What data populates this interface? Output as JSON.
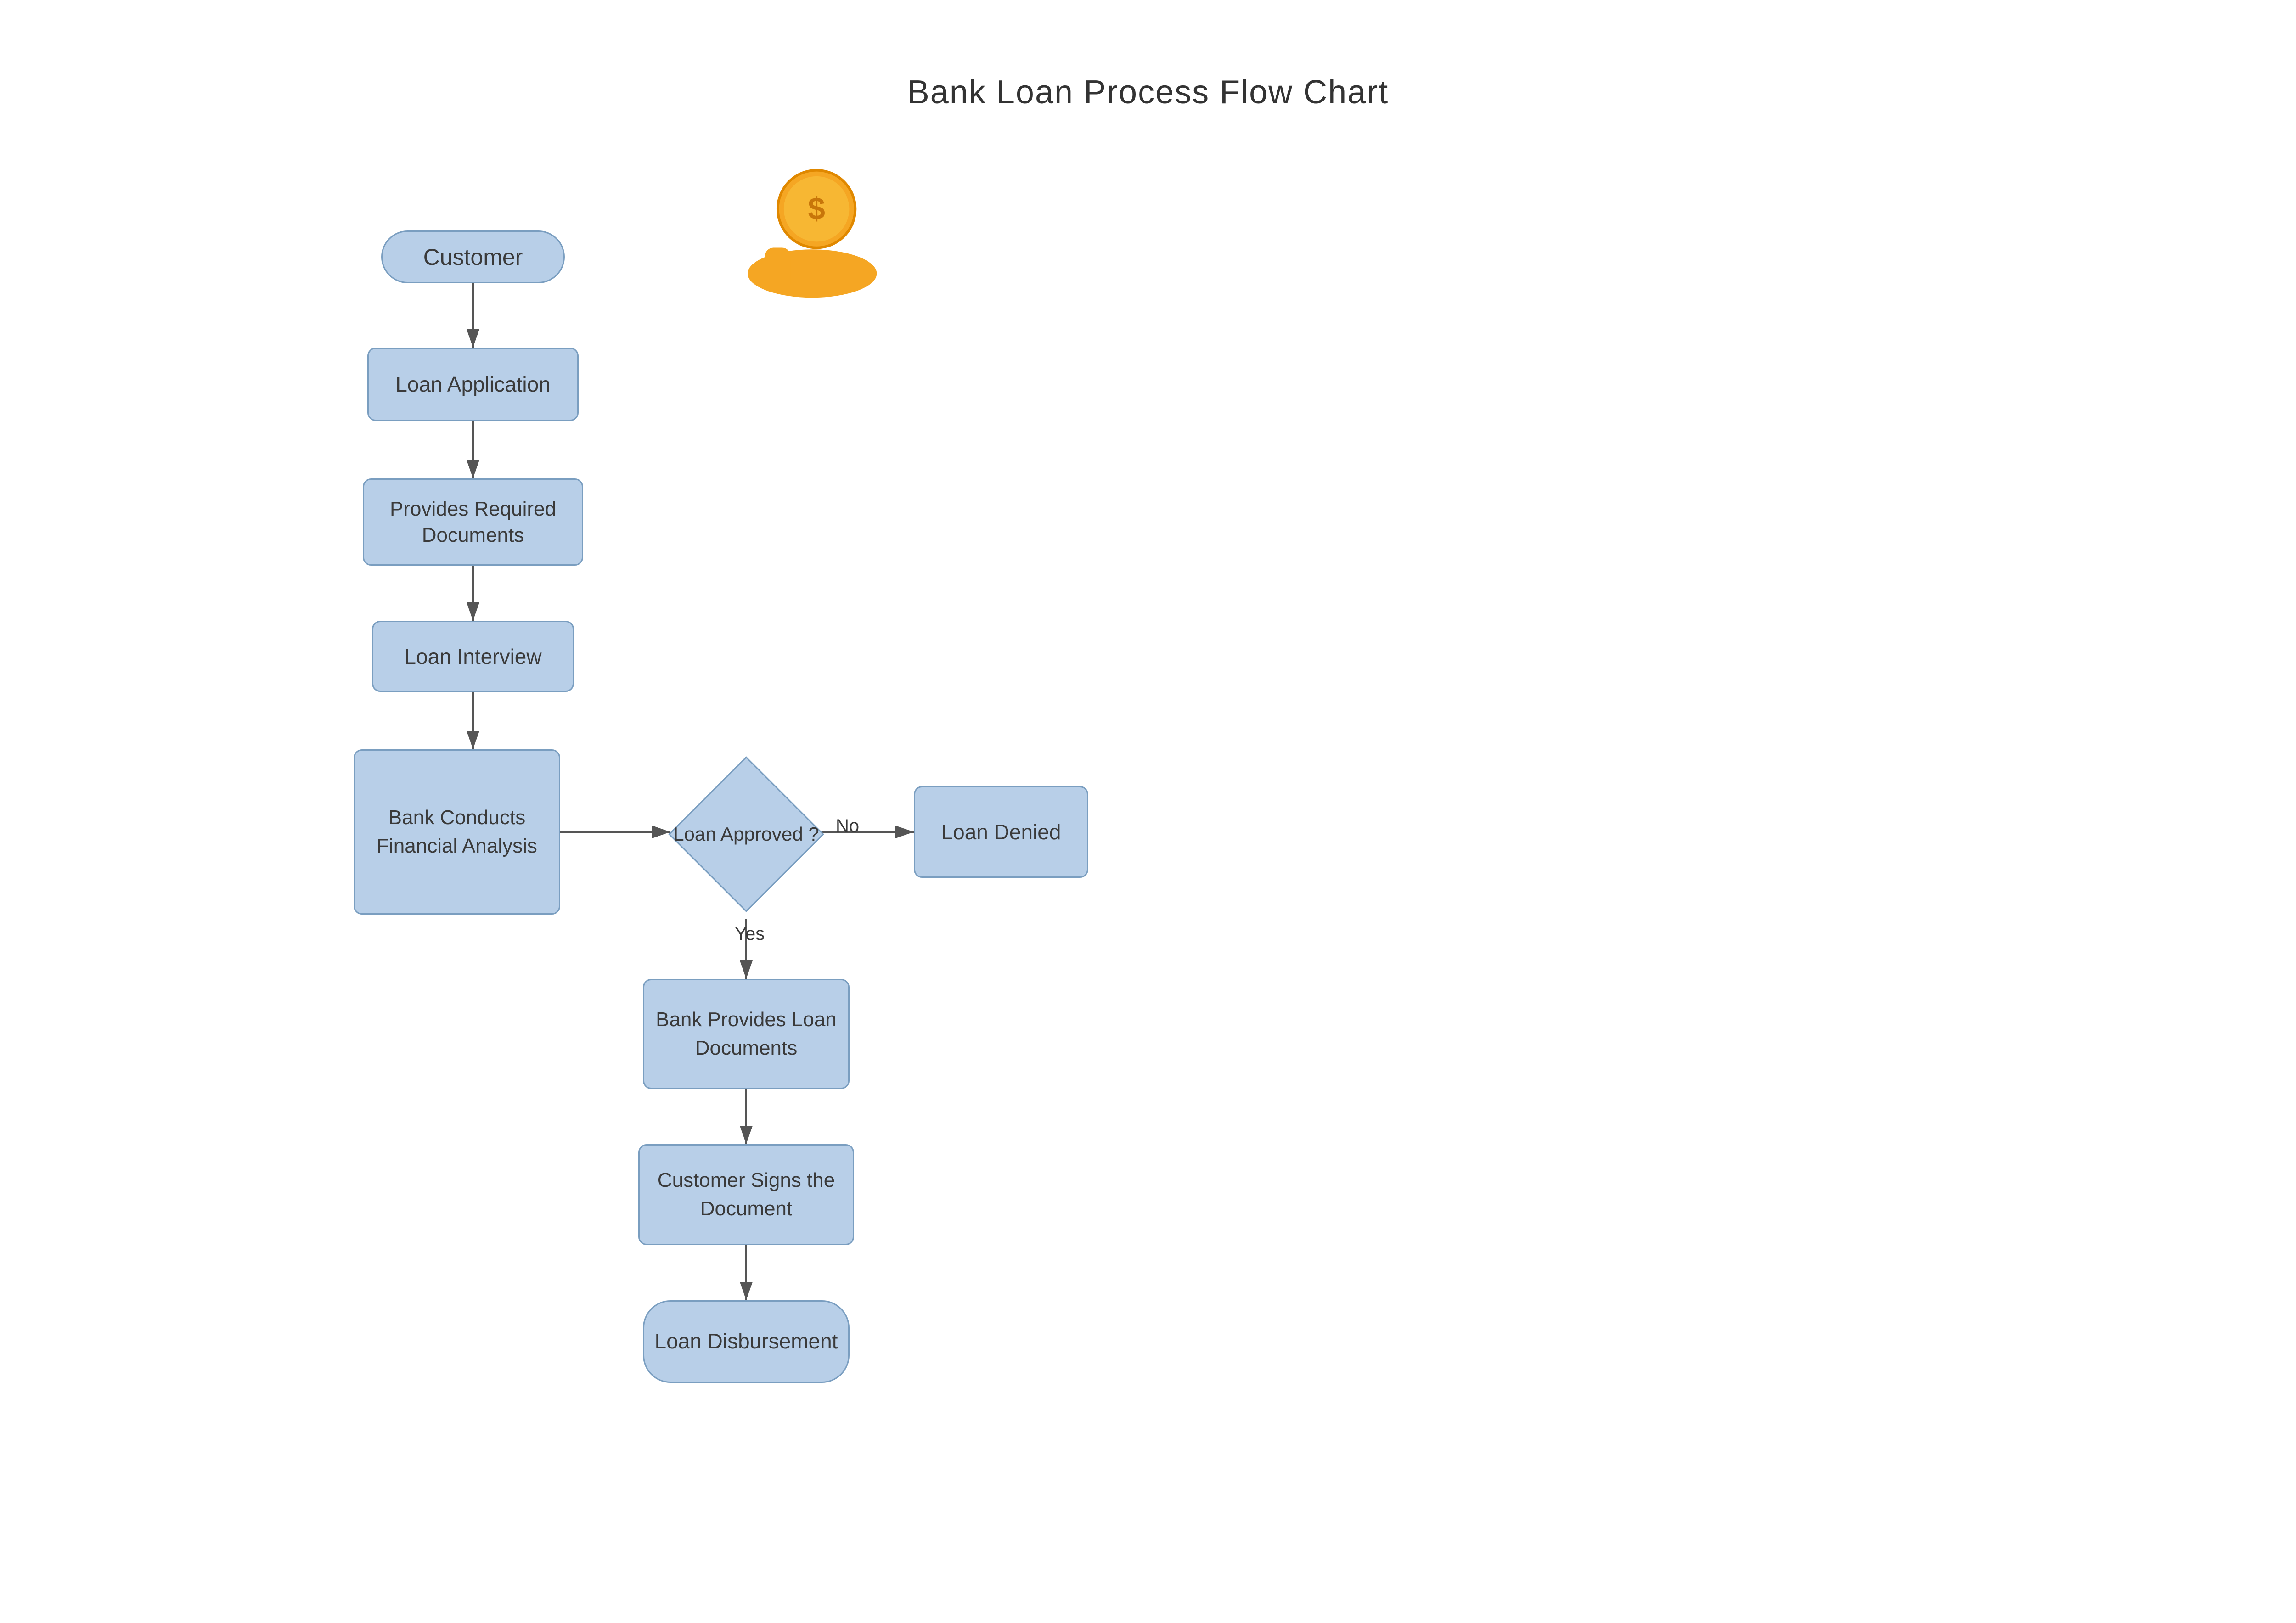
{
  "title": "Bank Loan Process Flow Chart",
  "nodes": {
    "customer": {
      "label": "Customer"
    },
    "loan_application": {
      "label": "Loan Application"
    },
    "provides_docs": {
      "label": "Provides Required Documents"
    },
    "loan_interview": {
      "label": "Loan Interview"
    },
    "bank_conducts": {
      "label": "Bank Conducts Financial Analysis"
    },
    "loan_approved": {
      "label": "Loan Approved ?"
    },
    "yes_label": {
      "label": "Yes"
    },
    "no_label": {
      "label": "No"
    },
    "loan_denied": {
      "label": "Loan Denied"
    },
    "bank_provides": {
      "label": "Bank Provides Loan Documents"
    },
    "customer_signs": {
      "label": "Customer Signs the Document"
    },
    "loan_disbursement": {
      "label": "Loan Disbursement"
    }
  },
  "colors": {
    "node_bg": "#b8cfe8",
    "node_border": "#7a9ec0",
    "arrow": "#555555",
    "text": "#3a3a3a",
    "orange": "#f5a623"
  }
}
